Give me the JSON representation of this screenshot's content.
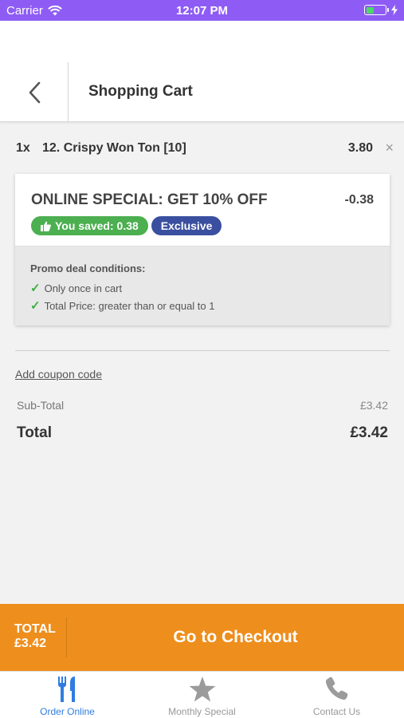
{
  "status_bar": {
    "carrier": "Carrier",
    "time": "12:07 PM"
  },
  "header": {
    "title": "Shopping Cart"
  },
  "cart_item": {
    "qty": "1x",
    "name": "12. Crispy Won Ton [10]",
    "price": "3.80",
    "remove": "×"
  },
  "promo": {
    "title": "ONLINE SPECIAL: GET 10% OFF",
    "amount": "-0.38",
    "saved_badge": "You saved: 0.38",
    "exclusive_badge": "Exclusive",
    "conditions_title": "Promo deal conditions:",
    "conditions": [
      "Only once in cart",
      "Total Price: greater than or equal to 1"
    ]
  },
  "coupon": {
    "label": "Add coupon code"
  },
  "totals": {
    "subtotal_label": "Sub-Total",
    "subtotal_value": "£3.42",
    "total_label": "Total",
    "total_value": "£3.42"
  },
  "checkout": {
    "total_label": "TOTAL",
    "total_value": "£3.42",
    "button_label": "Go to Checkout"
  },
  "tabs": [
    {
      "label": "Order Online",
      "icon": "fork-knife-icon",
      "active": true
    },
    {
      "label": "Monthly Special",
      "icon": "star-icon",
      "active": false
    },
    {
      "label": "Contact Us",
      "icon": "phone-icon",
      "active": false
    }
  ],
  "colors": {
    "status_bar": "#8e5cf5",
    "accent_orange": "#ee8e1c",
    "tab_active": "#2f7de1",
    "badge_green": "#4caf50",
    "badge_blue": "#3a4f9f"
  }
}
